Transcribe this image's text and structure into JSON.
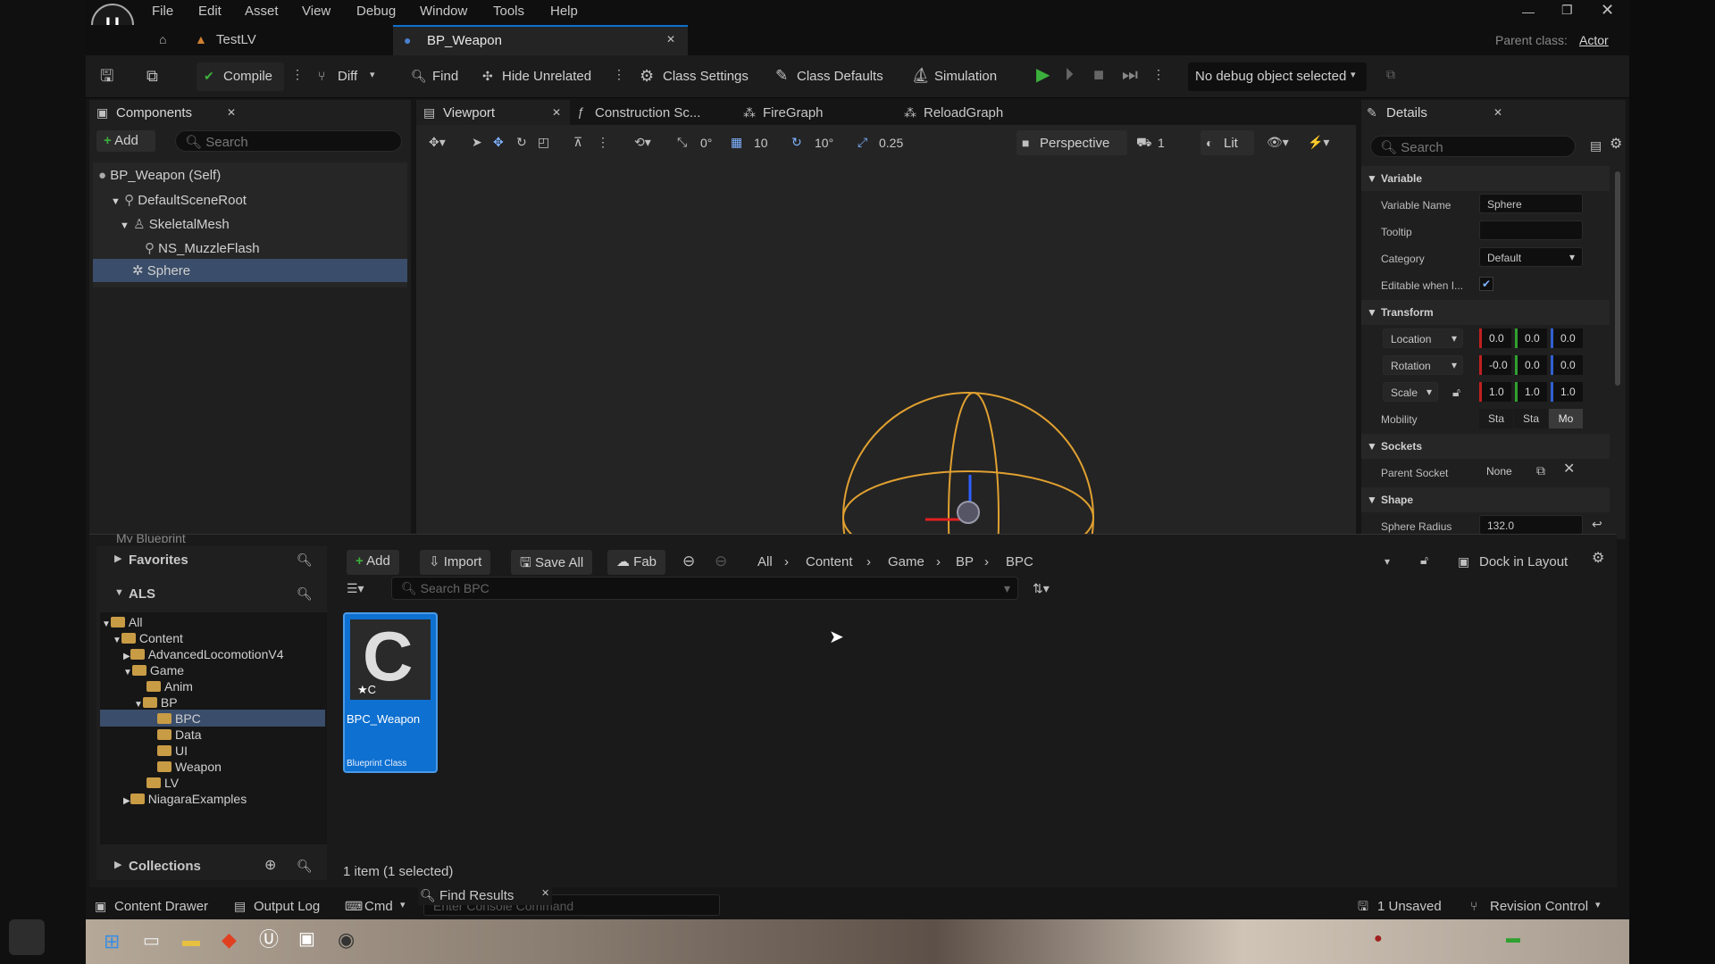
{
  "menubar": {
    "items": [
      "File",
      "Edit",
      "Asset",
      "View",
      "Debug",
      "Window",
      "Tools",
      "Help"
    ]
  },
  "tabs": {
    "level": "TestLV",
    "blueprint": "BP_Weapon",
    "parent_class_label": "Parent class:",
    "parent_class_value": "Actor"
  },
  "toolbar": {
    "compile": "Compile",
    "diff": "Diff",
    "find": "Find",
    "hide_unrelated": "Hide Unrelated",
    "class_settings": "Class Settings",
    "class_defaults": "Class Defaults",
    "simulation": "Simulation",
    "debug_object": "No debug object selected"
  },
  "components": {
    "title": "Components",
    "add": "Add",
    "search_placeholder": "Search",
    "items": [
      "BP_Weapon (Self)",
      "DefaultSceneRoot",
      "SkeletalMesh",
      "NS_MuzzleFlash",
      "Sphere"
    ]
  },
  "editor_tabs": [
    "Viewport",
    "Construction Sc...",
    "FireGraph",
    "ReloadGraph"
  ],
  "viewport": {
    "snap_angle": "0°",
    "grid": "10",
    "rot_snap": "10°",
    "scale_snap": "0.25",
    "perspective": "Perspective",
    "cam_speed": "1",
    "lit": "Lit"
  },
  "details": {
    "title": "Details",
    "search_placeholder": "Search",
    "variable": {
      "header": "Variable",
      "name_label": "Variable Name",
      "name_value": "Sphere",
      "tooltip_label": "Tooltip",
      "tooltip_value": "",
      "category_label": "Category",
      "category_value": "Default",
      "editable_label": "Editable when I..."
    },
    "transform": {
      "header": "Transform",
      "location": "Location",
      "rotation": "Rotation",
      "scale": "Scale",
      "loc": [
        "0.0",
        "0.0",
        "0.0"
      ],
      "rot": [
        "-0.0",
        "0.0",
        "0.0"
      ],
      "scl": [
        "1.0",
        "1.0",
        "1.0"
      ],
      "mobility_label": "Mobility",
      "mobility": [
        "Sta",
        "Sta",
        "Mo"
      ]
    },
    "sockets": {
      "header": "Sockets",
      "parent_socket_label": "Parent Socket",
      "parent_socket_value": "None"
    },
    "shape": {
      "header": "Shape",
      "radius_label": "Sphere Radius",
      "radius_value": "132.0"
    }
  },
  "content_browser": {
    "my_blueprint": "My Blueprint",
    "favorites": "Favorites",
    "als": "ALS",
    "collections": "Collections",
    "tree": [
      {
        "label": "All"
      },
      {
        "label": "Content"
      },
      {
        "label": "AdvancedLocomotionV4"
      },
      {
        "label": "Game"
      },
      {
        "label": "Anim"
      },
      {
        "label": "BP"
      },
      {
        "label": "BPC"
      },
      {
        "label": "Data"
      },
      {
        "label": "UI"
      },
      {
        "label": "Weapon"
      },
      {
        "label": "LV"
      },
      {
        "label": "NiagaraExamples"
      }
    ],
    "add": "Add",
    "import": "Import",
    "save_all": "Save All",
    "fab": "Fab",
    "breadcrumb": [
      "All",
      "Content",
      "Game",
      "BP",
      "BPC"
    ],
    "dock": "Dock in Layout",
    "search_placeholder": "Search BPC",
    "asset_name": "BPC_Weapon",
    "asset_type": "Blueprint Class",
    "status": "1 item (1 selected)"
  },
  "statusbar": {
    "content_drawer": "Content Drawer",
    "output_log": "Output Log",
    "cmd": "Cmd",
    "console_placeholder": "Enter Console Command",
    "find_results": "Find Results",
    "unsaved": "1 Unsaved",
    "revision": "Revision Control"
  },
  "colors": {
    "accent": "#0e70d0",
    "selected": "#3a4d6a",
    "folder": "#c89b45",
    "sphere": "#e0a030",
    "play": "#3cb03c"
  }
}
